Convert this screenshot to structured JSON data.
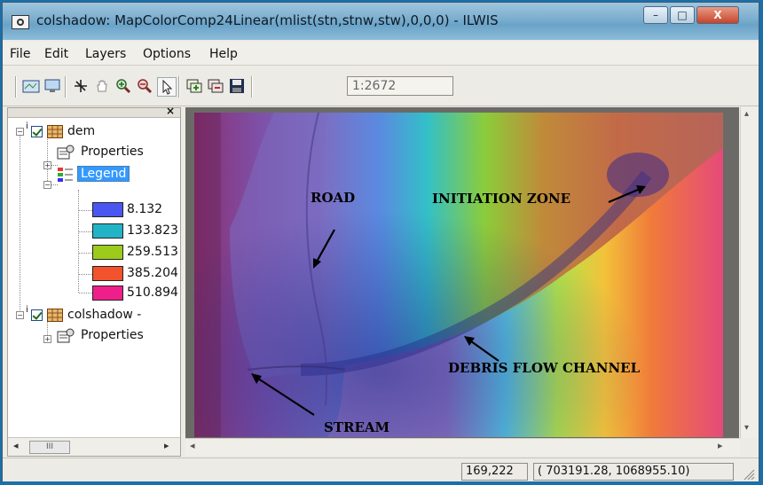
{
  "window": {
    "title": "colshadow: MapColorComp24Linear(mlist(stn,stnw,stw),0,0,0) - ILWIS",
    "min_label": "–",
    "max_label": "□",
    "close_label": "X"
  },
  "menu": [
    "File",
    "Edit",
    "Layers",
    "Options",
    "Help"
  ],
  "toolbar": {
    "scale": "1:2672",
    "icons": [
      "open-map-icon",
      "display-icon",
      "measure-icon",
      "pan-hand-icon",
      "zoom-in-icon",
      "zoom-out-icon",
      "select-pointer-icon",
      "add-layer-icon",
      "remove-layer-icon",
      "save-icon"
    ]
  },
  "layers": {
    "close_label": "×",
    "layer1": {
      "name": "dem",
      "properties_label": "Properties",
      "legend_label": "Legend"
    },
    "legend": [
      {
        "value": "8.132",
        "color": "#4a56f0"
      },
      {
        "value": "133.823",
        "color": "#22b4c6"
      },
      {
        "value": "259.513",
        "color": "#9ccb1c"
      },
      {
        "value": "385.204",
        "color": "#f2522c"
      },
      {
        "value": "510.894",
        "color": "#ee1f8a"
      }
    ],
    "layer2": {
      "name": "colshadow -",
      "properties_label": "Properties"
    },
    "scroll_label": "III"
  },
  "annotations": {
    "road": "ROAD",
    "initiation": "INITIATION ZONE",
    "debris": "DEBRIS FLOW CHANNEL",
    "stream": "STREAM"
  },
  "status": {
    "pixel": "169,222",
    "coords": "(  703191.28,  1068955.10)"
  }
}
